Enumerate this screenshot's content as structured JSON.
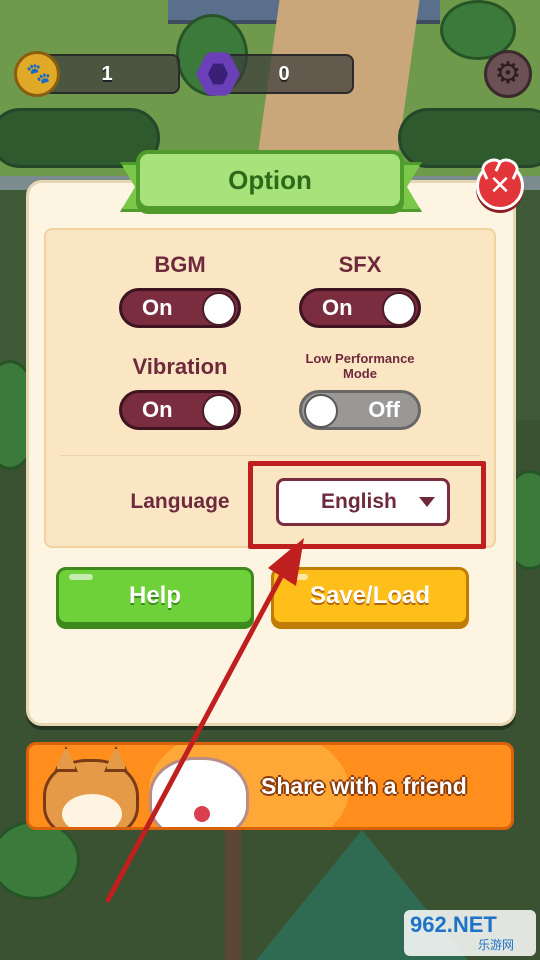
{
  "hud": {
    "coin_count": "1",
    "gem_count": "0",
    "coin_icon": "paw-coin-icon",
    "gem_icon": "purple-gem-icon",
    "settings_icon": "gear-icon"
  },
  "dialog": {
    "title": "Option",
    "close_icon": "close-icon",
    "settings": {
      "bgm": {
        "label": "BGM",
        "state": "On"
      },
      "sfx": {
        "label": "SFX",
        "state": "On"
      },
      "vibration": {
        "label": "Vibration",
        "state": "On"
      },
      "low_performance": {
        "label_line1": "Low Performance",
        "label_line2": "Mode",
        "state": "Off"
      }
    },
    "language": {
      "label": "Language",
      "selected": "English"
    },
    "buttons": {
      "help": "Help",
      "save_load": "Save/Load"
    }
  },
  "share_banner": {
    "text": "Share with a friend"
  },
  "watermark": {
    "main": "962.NET",
    "sub": "乐游网"
  },
  "colors": {
    "toggle_on": "#7a2d3f",
    "toggle_off": "#9a9896",
    "help_button": "#6fd13a",
    "save_button": "#ffbf1a",
    "title_banner": "#a8e27b",
    "close_button": "#e2363a",
    "annotation": "#c01f1f"
  }
}
